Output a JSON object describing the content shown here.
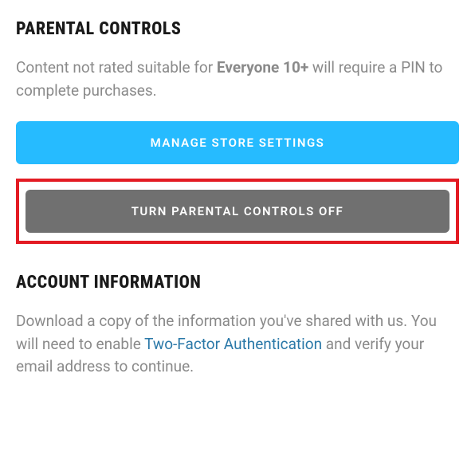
{
  "parental": {
    "heading": "PARENTAL CONTROLS",
    "desc_prefix": "Content not rated suitable for ",
    "desc_bold": "Everyone 10+",
    "desc_suffix": " will require a PIN to complete purchases.",
    "manage_button": "MANAGE STORE SETTINGS",
    "turn_off_button": "TURN PARENTAL CONTROLS OFF"
  },
  "account": {
    "heading": "ACCOUNT INFORMATION",
    "desc_part1": "Download a copy of the information you've shared with us. You will need to enable ",
    "desc_link": "Two-Factor Authentication",
    "desc_part2": " and verify your email address to continue."
  }
}
